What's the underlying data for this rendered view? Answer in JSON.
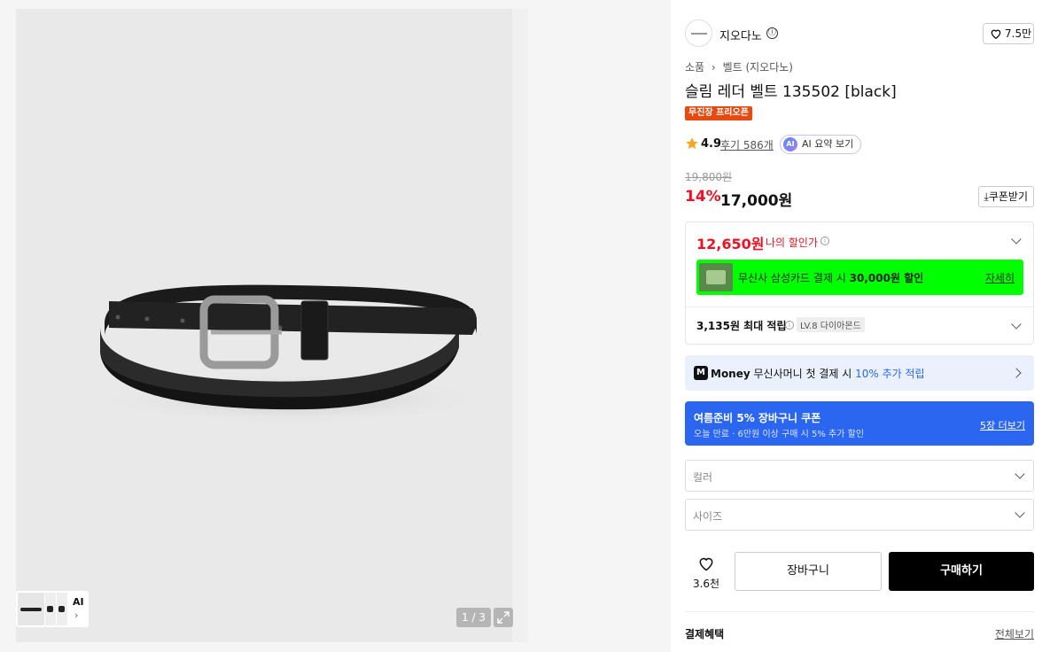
{
  "gallery": {
    "pager": "1 / 3",
    "thumbs_ai_label": "AI",
    "thumbs_ai_arrow": "›"
  },
  "brand": {
    "name": "지오다노",
    "info_icon": "ⓘ",
    "likes": "7.5만"
  },
  "breadcrumb": {
    "category": "소품",
    "separator": "›",
    "subcategory": "벨트 (지오다노)"
  },
  "product": {
    "title": "슬림 레더 벨트 135502 [black]",
    "badge": "무진장 프리오픈"
  },
  "rating": {
    "score": "4.9",
    "reviews": "후기 586개",
    "ai_icon_text": "AI",
    "ai_summary": "AI 요약 보기"
  },
  "price": {
    "original": "19,800원",
    "discount": "14%",
    "current": "17,000원",
    "coupon_button": "⤓쿠폰받기"
  },
  "my_price": {
    "amount": "12,650원",
    "label": "나의 할인가",
    "info": "i",
    "card_text_prefix": "무신사 삼성카드 결제 시 ",
    "card_text_amount": "30,000원 할인",
    "card_more": "자세히",
    "points": "3,135원 최대 적립",
    "points_info": "i",
    "level": "LV.8 다이아몬드"
  },
  "money_bar": {
    "logo": "M",
    "brand": "Money",
    "text": " 무신사머니 첫 결제 시 ",
    "highlight": "10% 추가 적립"
  },
  "coupon_bar": {
    "title": "여름준비 5% 장바구니 쿠폰",
    "subtitle": "오늘 만료 · 6만원 이상 구매 시 5% 추가 할인",
    "more": "5장 더보기"
  },
  "options": {
    "color_label": "컬러",
    "size_label": "사이즈"
  },
  "actions": {
    "wish_count": "3.6천",
    "cart_label": "장바구니",
    "buy_label": "구매하기"
  },
  "benefits": {
    "title": "결제혜택",
    "view_all": "전체보기"
  },
  "colors": {
    "accent_red": "#e11122",
    "badge_orange": "#e8490f",
    "card_banner_green": "#00ff00",
    "coupon_blue": "#2a66f0",
    "money_bg": "#eaf1fd"
  }
}
